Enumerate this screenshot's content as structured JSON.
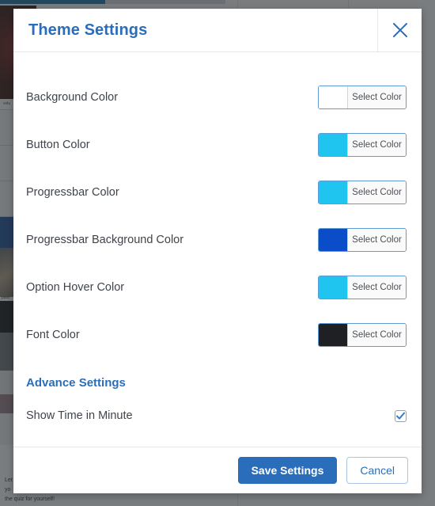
{
  "modal": {
    "title": "Theme Settings",
    "close_icon": "close-icon",
    "color_rows": [
      {
        "label": "Background Color",
        "button_label": "Select Color",
        "swatch_color": "#ffffff"
      },
      {
        "label": "Button Color",
        "button_label": "Select Color",
        "swatch_color": "#1fc4ef"
      },
      {
        "label": "Progressbar Color",
        "button_label": "Select Color",
        "swatch_color": "#1fc4ef"
      },
      {
        "label": "Progressbar Background Color",
        "button_label": "Select Color",
        "swatch_color": "#0b4cc9"
      },
      {
        "label": "Option Hover Color",
        "button_label": "Select Color",
        "swatch_color": "#1fc4ef"
      },
      {
        "label": "Font Color",
        "button_label": "Select Color",
        "swatch_color": "#1f2023"
      }
    ],
    "advance_section": {
      "heading": "Advance Settings",
      "toggle_label": "Show Time in Minute",
      "toggle_checked": true
    },
    "footer": {
      "save_label": "Save Settings",
      "cancel_label": "Cancel"
    },
    "accent_color": "#2a6ebb"
  },
  "backdrop": {
    "footer_text_line1": "Let",
    "footer_text_line2": "yo",
    "footer_text_line3": "the quiz for yourself!",
    "side_text": "volu",
    "side_text2": "pass"
  }
}
